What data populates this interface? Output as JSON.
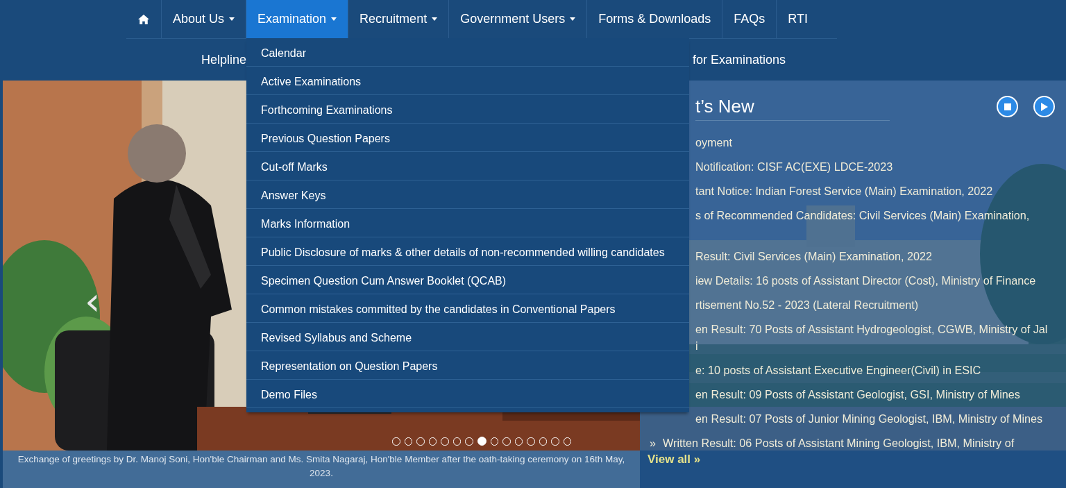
{
  "nav": {
    "items": [
      {
        "kind": "home",
        "selected": false
      },
      {
        "kind": "text",
        "label": "About Us",
        "dropdown": true,
        "selected": false
      },
      {
        "kind": "text",
        "label": "Examination",
        "dropdown": true,
        "selected": true
      },
      {
        "kind": "text",
        "label": "Recruitment",
        "dropdown": true,
        "selected": false
      },
      {
        "kind": "text",
        "label": "Government Users",
        "dropdown": true,
        "selected": false
      },
      {
        "kind": "text",
        "label": "Forms & Downloads",
        "dropdown": false,
        "selected": false
      },
      {
        "kind": "text",
        "label": "FAQs",
        "dropdown": false,
        "selected": false
      },
      {
        "kind": "text",
        "label": "RTI",
        "dropdown": false,
        "selected": false
      }
    ],
    "menu": {
      "items": [
        "Calendar",
        "Active Examinations",
        "Forthcoming Examinations",
        "Previous Question Papers",
        "Cut-off Marks",
        "Answer Keys",
        "Marks Information",
        "Public Disclosure of marks & other details of non-recommended willing candidates",
        "Specimen Question Cum Answer Booklet (QCAB)",
        "Common mistakes committed by the candidates in Conventional Papers",
        "Revised Syllabus and Scheme",
        "Representation on Question Papers",
        "Demo Files"
      ]
    }
  },
  "subnav": [
    "Helpline",
    "for Examinations"
  ],
  "carousel": {
    "prev": "‹",
    "caption": "Exchange of greetings by Dr. Manoj Soni, Hon'ble Chairman and Ms. Smita Nagaraj, Hon'ble Member after the oath-taking ceremony on 16th May, 2023.",
    "slides": [
      {
        "selected": false
      },
      {
        "selected": false
      },
      {
        "selected": false
      },
      {
        "selected": false
      },
      {
        "selected": false
      },
      {
        "selected": false
      },
      {
        "selected": false
      },
      {
        "selected": true
      },
      {
        "selected": false
      },
      {
        "selected": false
      },
      {
        "selected": false
      },
      {
        "selected": false
      },
      {
        "selected": false
      },
      {
        "selected": false
      },
      {
        "selected": false
      }
    ]
  },
  "news": {
    "title": "t’s New",
    "items": [
      {
        "kind": "partial",
        "lines": [
          "oyment"
        ]
      },
      {
        "kind": "partial",
        "lines": [
          "Notification: CISF AC(EXE) LDCE-2023"
        ]
      },
      {
        "kind": "partial",
        "lines": [
          "tant Notice: Indian Forest Service (Main) Examination, 2022"
        ]
      },
      {
        "kind": "partial",
        "lines": [
          "s of Recommended Candidates: Civil Services (Main) Examination,"
        ],
        "continued": true
      },
      {
        "kind": "partial",
        "lines": [
          "Result: Civil Services (Main) Examination, 2022"
        ]
      },
      {
        "kind": "partial",
        "lines": [
          "iew Details: 16 posts of Assistant Director (Cost), Ministry of Finance"
        ]
      },
      {
        "kind": "partial",
        "lines": [
          "rtisement No.52 - 2023 (Lateral Recruitment)"
        ]
      },
      {
        "kind": "partial",
        "lines": [
          "en Result: 70 Posts of Assistant Hydrogeologist, CGWB, Ministry of Jal",
          "i"
        ]
      },
      {
        "kind": "partial",
        "lines": [
          "e: 10 posts of Assistant Executive Engineer(Civil) in ESIC"
        ]
      },
      {
        "kind": "partial",
        "lines": [
          "en Result: 09 Posts of Assistant Geologist, GSI, Ministry of Mines"
        ]
      },
      {
        "kind": "partial",
        "lines": [
          "en Result: 07 Posts of Junior Mining Geologist, IBM, Ministry of Mines"
        ]
      },
      {
        "kind": "full",
        "bullet": "»",
        "lines": [
          "Written Result: 06 Posts of Assistant Mining Geologist, IBM, Ministry of"
        ]
      }
    ],
    "view_all": "View all »"
  }
}
